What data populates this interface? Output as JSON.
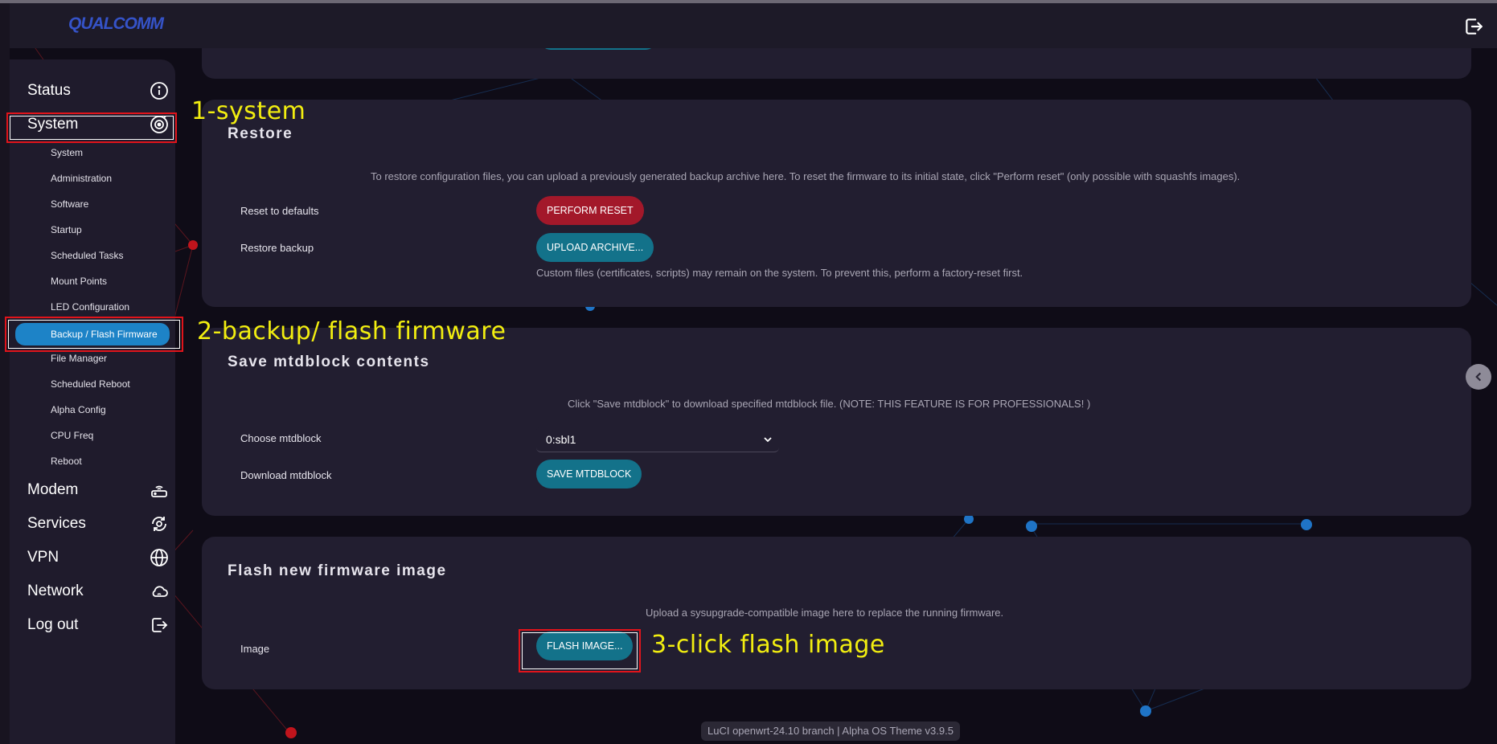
{
  "header": {
    "logo": "QUALCOMM"
  },
  "sidebar": {
    "main": [
      {
        "label": "Status",
        "icon": "info-icon"
      },
      {
        "label": "System",
        "icon": "system-icon"
      },
      {
        "label": "Modem",
        "icon": "router-icon"
      },
      {
        "label": "Services",
        "icon": "services-icon"
      },
      {
        "label": "VPN",
        "icon": "globe-icon"
      },
      {
        "label": "Network",
        "icon": "cloud-icon"
      },
      {
        "label": "Log out",
        "icon": "logout-icon"
      }
    ],
    "system_sub": [
      "System",
      "Administration",
      "Software",
      "Startup",
      "Scheduled Tasks",
      "Mount Points",
      "LED Configuration",
      "Backup / Flash Firmware",
      "File Manager",
      "Scheduled Reboot",
      "Alpha Config",
      "CPU Freq",
      "Reboot"
    ],
    "active_sub": "Backup / Flash Firmware"
  },
  "restore": {
    "title": "Restore",
    "description": "To restore configuration files, you can upload a previously generated backup archive here. To reset the firmware to its initial state, click \"Perform reset\" (only possible with squashfs images).",
    "reset_label": "Reset to defaults",
    "reset_button": "PERFORM RESET",
    "restore_label": "Restore backup",
    "upload_button": "UPLOAD ARCHIVE...",
    "note": "Custom files (certificates, scripts) may remain on the system. To prevent this, perform a factory-reset first."
  },
  "mtd": {
    "title": "Save mtdblock contents",
    "description": "Click \"Save mtdblock\" to download specified mtdblock file. (NOTE: THIS FEATURE IS FOR PROFESSIONALS! )",
    "choose_label": "Choose mtdblock",
    "selected": "0:sbl1",
    "download_label": "Download mtdblock",
    "save_button": "SAVE MTDBLOCK"
  },
  "flash": {
    "title": "Flash new firmware image",
    "description": "Upload a sysupgrade-compatible image here to replace the running firmware.",
    "image_label": "Image",
    "flash_button": "FLASH IMAGE..."
  },
  "annotations": {
    "step1": "1-system",
    "step2": "2-backup/ flash firmware",
    "step3": "3-click flash image"
  },
  "footer": "LuCI openwrt-24.10 branch | Alpha OS Theme v3.9.5",
  "colors": {
    "accent_teal": "#13728a",
    "danger_red": "#a3182a",
    "active_blue": "#1d83c7",
    "annotation_yellow": "#f2ee10",
    "annotation_border": "#e0141b"
  }
}
